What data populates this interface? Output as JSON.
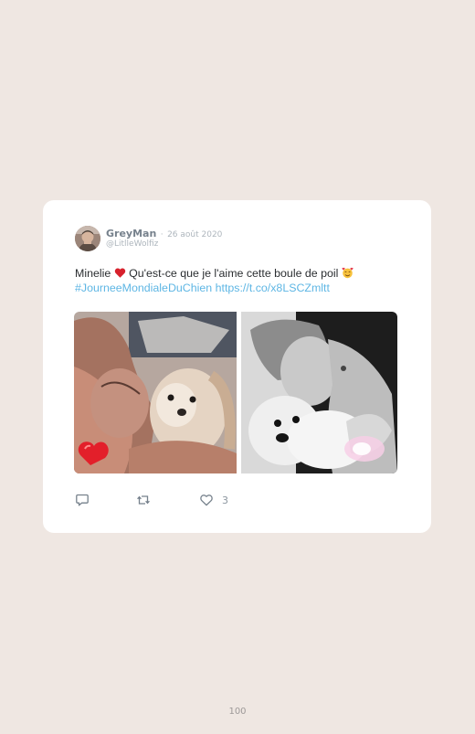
{
  "tweet": {
    "author": {
      "display_name": "GreyMan",
      "username": "@LitlleWolfiz",
      "avatar_icon": "user-avatar-icon"
    },
    "separator": "·",
    "date": "26 août 2020",
    "text": {
      "part1": "Minelie ",
      "emoji1": "red-heart-emoji",
      "part2": " Qu'est-ce que je l'aime cette boule de poil ",
      "emoji2": "smiling-face-with-hearts-emoji",
      "hashtag": "#JourneeMondialeDuChien",
      "url": "https://t.co/x8LSCZmltt"
    },
    "media": [
      {
        "description_icon": "photo-icon"
      },
      {
        "description_icon": "photo-icon"
      }
    ],
    "actions": {
      "reply_icon": "reply-icon",
      "retweet_icon": "retweet-icon",
      "like_icon": "heart-icon",
      "like_count": "3"
    }
  },
  "page": {
    "number": "100"
  },
  "colors": {
    "background": "#efe7e2",
    "card": "#ffffff",
    "link": "#5eb6e4",
    "muted": "#aeb6bd",
    "name": "#76818c"
  }
}
